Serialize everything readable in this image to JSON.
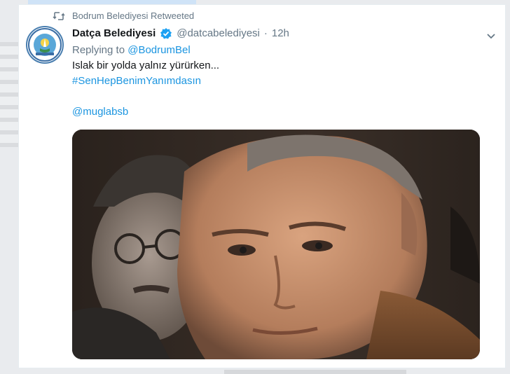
{
  "retweet": {
    "icon": "retweet-icon",
    "text": "Bodrum Belediyesi Retweeted"
  },
  "tweet": {
    "author_name": "Datça Belediyesi",
    "handle": "@datcabelediyesi",
    "separator": "·",
    "time": "12h",
    "replying_prefix": "Replying to",
    "replying_to": "@BodrumBel",
    "text": "Islak bir yolda yalnız yürürken...",
    "hashtag": "#SenHepBenimYanımdasın",
    "mention": "@muglabsb",
    "verified_color": "#1da1f2",
    "link_color": "#1b95e0"
  }
}
